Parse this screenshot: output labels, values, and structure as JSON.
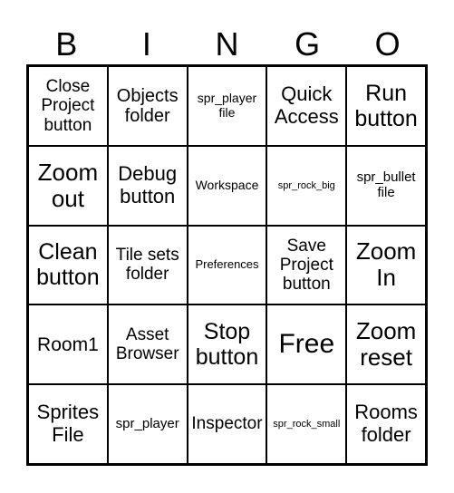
{
  "header": {
    "letters": [
      "B",
      "I",
      "N",
      "G",
      "O"
    ]
  },
  "cells": [
    [
      "Close Project button",
      "Objects folder",
      "spr_player file",
      "Quick Access",
      "Run button"
    ],
    [
      "Zoom out",
      "Debug button",
      "Workspace",
      "spr_rock_big",
      "spr_bullet file"
    ],
    [
      "Clean button",
      "Tile sets folder",
      "Preferences",
      "Save Project button",
      "Zoom In"
    ],
    [
      "Room1",
      "Asset Browser",
      "Stop button",
      "Free",
      "Zoom reset"
    ],
    [
      "Sprites File",
      "spr_player",
      "Inspector",
      "spr_rock_small",
      "Rooms folder"
    ]
  ]
}
